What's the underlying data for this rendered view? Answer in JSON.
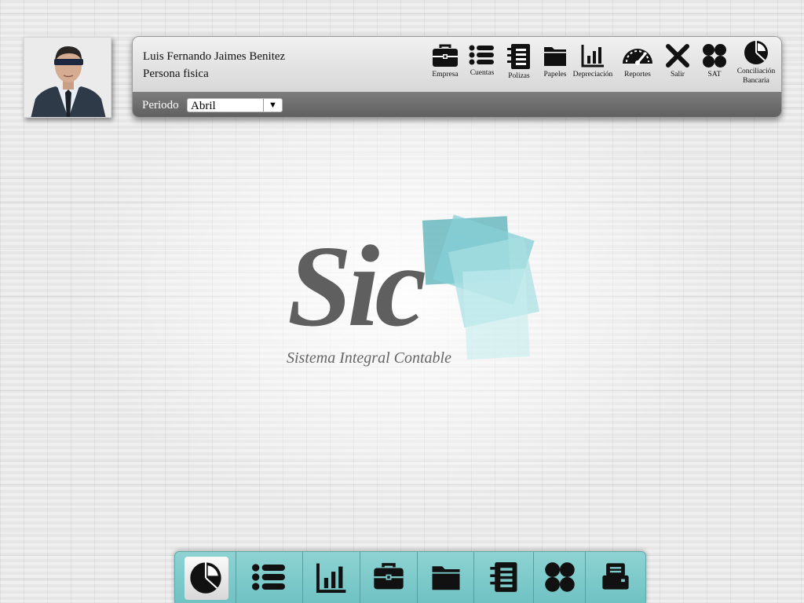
{
  "user": {
    "name": "Luis Fernando Jaimes Benitez",
    "type": "Persona fisica"
  },
  "toolbar": [
    {
      "label": "Empresa",
      "icon": "briefcase-icon"
    },
    {
      "label": "Cuentas",
      "icon": "list-icon"
    },
    {
      "label": "Polizas",
      "icon": "ledger-icon"
    },
    {
      "label": "Papeles",
      "icon": "folder-icon"
    },
    {
      "label": "Depreciación",
      "icon": "bar-chart-icon"
    },
    {
      "label": "Reportes",
      "icon": "gauge-icon"
    },
    {
      "label": "Salir",
      "icon": "close-icon"
    },
    {
      "label": "SAT",
      "icon": "four-dots-icon"
    },
    {
      "label": "Conciliación Bancaria",
      "icon": "pie-chart-icon"
    }
  ],
  "period": {
    "label": "Periodo",
    "value": "Abril"
  },
  "logo": {
    "text": "Sic",
    "subtitle": "Sistema Integral Contable"
  },
  "dock": [
    {
      "icon": "pie-chart-icon",
      "active": true
    },
    {
      "icon": "list-icon"
    },
    {
      "icon": "bar-chart-icon"
    },
    {
      "icon": "briefcase-icon"
    },
    {
      "icon": "folder-icon"
    },
    {
      "icon": "ledger-icon"
    },
    {
      "icon": "four-dots-icon"
    },
    {
      "icon": "printer-icon"
    }
  ],
  "colors": {
    "dock": "#7ccaca",
    "logo_gray": "#5f5f5f",
    "logo_teal": "#6fc0c8"
  }
}
